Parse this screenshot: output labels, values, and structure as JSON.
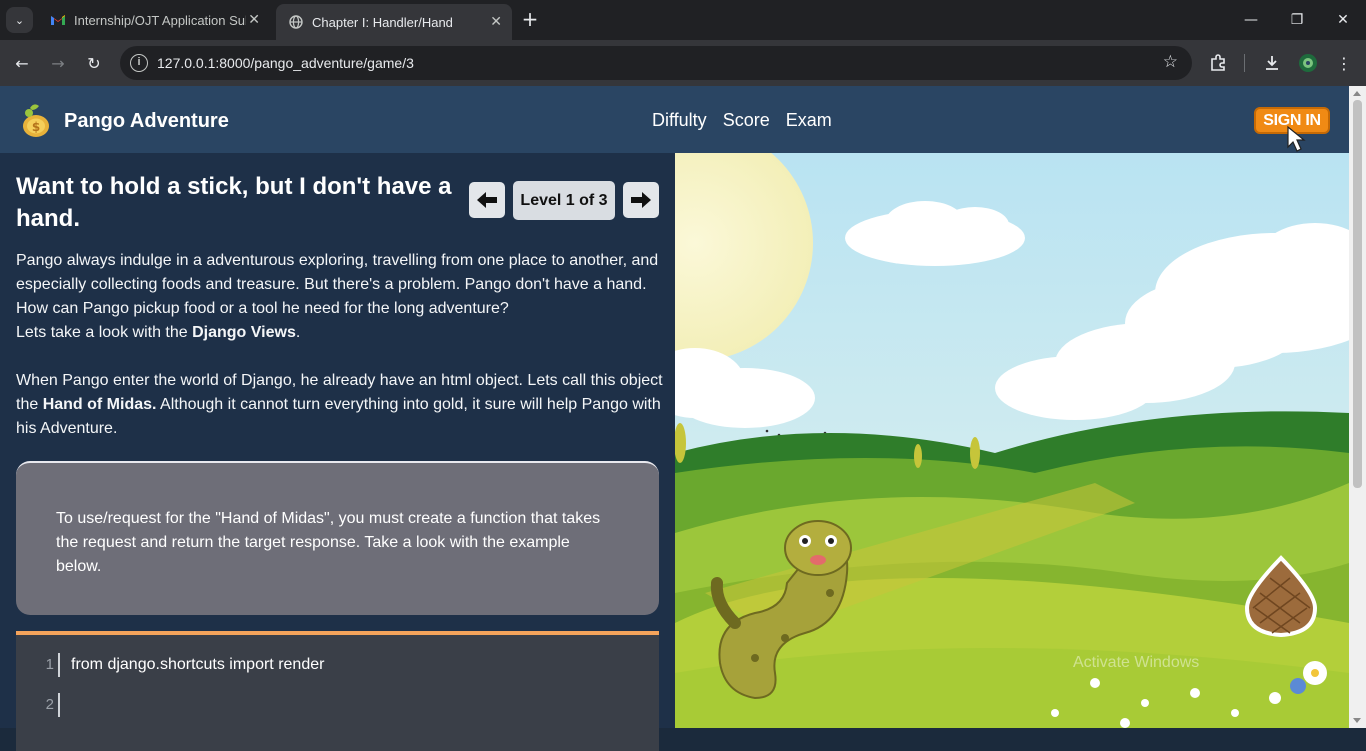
{
  "browser": {
    "tabs": [
      {
        "title": "Internship/OJT Application Sub",
        "active": false
      },
      {
        "title": "Chapter I: Handler/Hand",
        "active": true
      }
    ],
    "url": "127.0.0.1:8000/pango_adventure/game/3"
  },
  "site": {
    "brand": "Pango Adventure",
    "nav": [
      "Diffulty",
      "Score",
      "Exam"
    ],
    "signin": "SIGN IN"
  },
  "lesson": {
    "heading": "Want to hold a stick, but I don't have a hand.",
    "level_label": "Level 1 of 3",
    "para1_text": "Pango always indulge in a adventurous exploring, travelling from one place to another, and especially collecting foods and treasure. But there's a problem. Pango don't have a hand. How can Pango pickup food or a tool he need for the long adventure?",
    "para1_lead": "Lets take a look with the ",
    "para1_bold": "Django Views",
    "para1_end": ".",
    "para2_text": "When Pango enter the world of Django, he already have an html object. Lets call this object the ",
    "para2_bold": "Hand of Midas.",
    "para2_end": " Although it cannot turn everything into gold, it sure will help Pango with his Adventure.",
    "note": "To use/request for the \"Hand of Midas\", you must create a function that takes the request and return the target response. Take a look with the example below.",
    "code": [
      {
        "num": "1",
        "text": "from django.shortcuts import render"
      },
      {
        "num": "2",
        "text": ""
      }
    ]
  },
  "watermark": "Activate Windows",
  "colors": {
    "header": "#2a4563",
    "panel": "#1e3048",
    "signin": "#f08a14",
    "code_accent": "#f4a35b"
  }
}
